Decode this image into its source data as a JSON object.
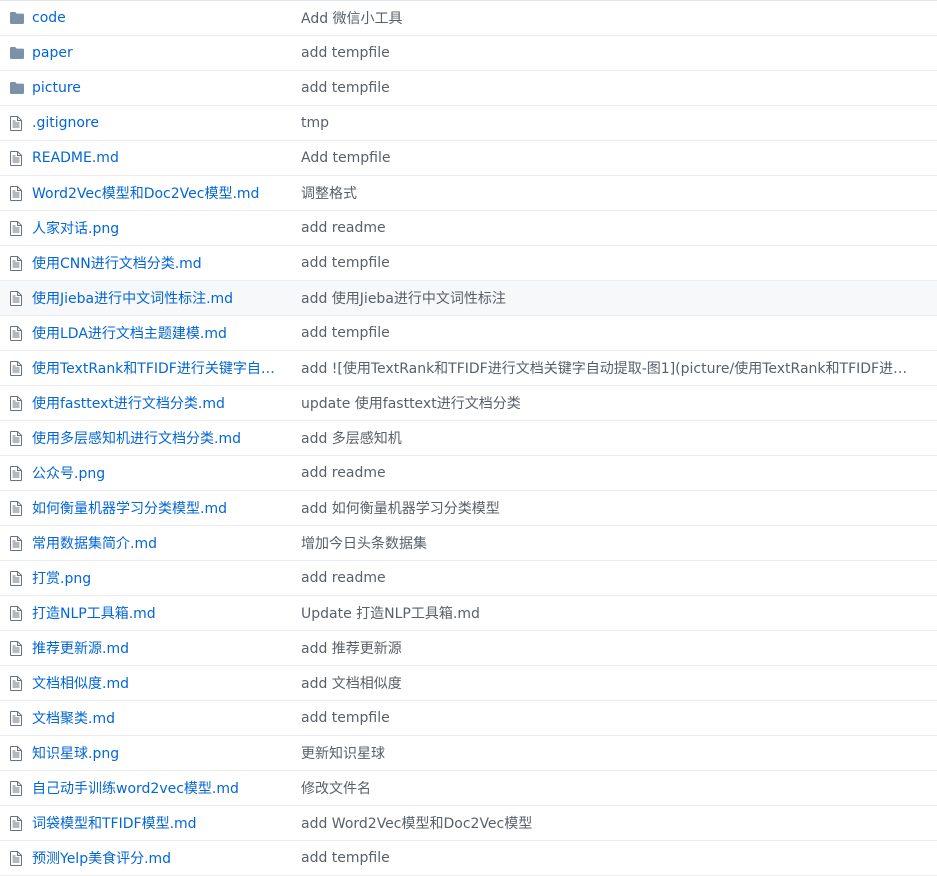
{
  "colors": {
    "link": "#0366d6",
    "message": "#586069",
    "folder_icon": "#79b8ff",
    "file_icon": "#6a737d",
    "row_border": "#eaecef",
    "highlight_bg": "#f6f8fa"
  },
  "files": [
    {
      "type": "folder",
      "icon": "folder-icon",
      "name": "code",
      "message": "Add 微信小工具"
    },
    {
      "type": "folder",
      "icon": "folder-icon",
      "name": "paper",
      "message": "add tempfile"
    },
    {
      "type": "folder",
      "icon": "folder-icon",
      "name": "picture",
      "message": "add tempfile"
    },
    {
      "type": "file",
      "icon": "file-icon",
      "name": ".gitignore",
      "message": "tmp"
    },
    {
      "type": "file",
      "icon": "file-icon",
      "name": "README.md",
      "message": "Add tempfile"
    },
    {
      "type": "file",
      "icon": "file-icon",
      "name": "Word2Vec模型和Doc2Vec模型.md",
      "message": "调整格式"
    },
    {
      "type": "file",
      "icon": "file-icon",
      "name": "人家对话.png",
      "message": "add readme"
    },
    {
      "type": "file",
      "icon": "file-icon",
      "name": "使用CNN进行文档分类.md",
      "message": "add tempfile"
    },
    {
      "type": "file",
      "icon": "file-icon",
      "name": "使用Jieba进行中文词性标注.md",
      "message": "add 使用Jieba进行中文词性标注",
      "highlighted": true
    },
    {
      "type": "file",
      "icon": "file-icon",
      "name": "使用LDA进行文档主题建模.md",
      "message": "add tempfile"
    },
    {
      "type": "file",
      "icon": "file-icon",
      "name": "使用TextRank和TFIDF进行关键字自…",
      "message": "add ![使用TextRank和TFIDF进行文档关键字自动提取-图1](picture/使用TextRank和TFIDF进…"
    },
    {
      "type": "file",
      "icon": "file-icon",
      "name": "使用fasttext进行文档分类.md",
      "message": "update 使用fasttext进行文档分类"
    },
    {
      "type": "file",
      "icon": "file-icon",
      "name": "使用多层感知机进行文档分类.md",
      "message": "add 多层感知机"
    },
    {
      "type": "file",
      "icon": "file-icon",
      "name": "公众号.png",
      "message": "add readme"
    },
    {
      "type": "file",
      "icon": "file-icon",
      "name": "如何衡量机器学习分类模型.md",
      "message": "add 如何衡量机器学习分类模型"
    },
    {
      "type": "file",
      "icon": "file-icon",
      "name": "常用数据集简介.md",
      "message": "增加今日头条数据集"
    },
    {
      "type": "file",
      "icon": "file-icon",
      "name": "打赏.png",
      "message": "add readme"
    },
    {
      "type": "file",
      "icon": "file-icon",
      "name": "打造NLP工具箱.md",
      "message": "Update 打造NLP工具箱.md"
    },
    {
      "type": "file",
      "icon": "file-icon",
      "name": "推荐更新源.md",
      "message": "add 推荐更新源"
    },
    {
      "type": "file",
      "icon": "file-icon",
      "name": "文档相似度.md",
      "message": "add 文档相似度"
    },
    {
      "type": "file",
      "icon": "file-icon",
      "name": "文档聚类.md",
      "message": "add tempfile"
    },
    {
      "type": "file",
      "icon": "file-icon",
      "name": "知识星球.png",
      "message": "更新知识星球"
    },
    {
      "type": "file",
      "icon": "file-icon",
      "name": "自己动手训练word2vec模型.md",
      "message": "修改文件名"
    },
    {
      "type": "file",
      "icon": "file-icon",
      "name": "词袋模型和TFIDF模型.md",
      "message": "add Word2Vec模型和Doc2Vec模型"
    },
    {
      "type": "file",
      "icon": "file-icon",
      "name": "预测Yelp美食评分.md",
      "message": "add tempfile"
    }
  ]
}
